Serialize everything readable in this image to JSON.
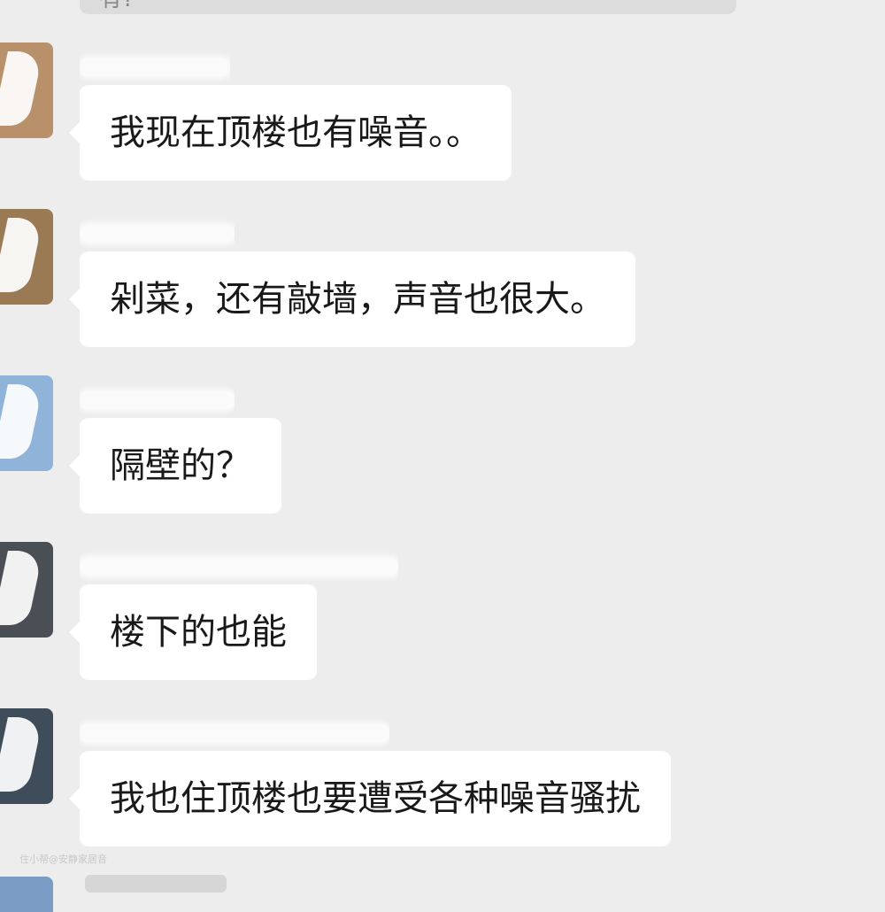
{
  "top_message": {
    "partial_text": "有?"
  },
  "messages": [
    {
      "sender": "",
      "text": "我现在顶楼也有噪音。。",
      "avatar_color": "#b8916a"
    },
    {
      "sender": "",
      "text": "剁菜，还有敲墙，声音也很大。",
      "avatar_color": "#9a7a55"
    },
    {
      "sender": "",
      "text": "隔壁的？",
      "avatar_color": "#8fb3d9"
    },
    {
      "sender": "",
      "text": "楼下的也能",
      "avatar_color": "#4a4f55"
    },
    {
      "sender": "",
      "text": "我也住顶楼也要遭受各种噪音骚扰",
      "avatar_color": "#3f4c5a"
    }
  ],
  "watermark": "住小帮@安静家居音",
  "colors": {
    "background": "#ededed",
    "bubble": "#ffffff",
    "text": "#191919",
    "sender_text": "#b0b0b0"
  }
}
